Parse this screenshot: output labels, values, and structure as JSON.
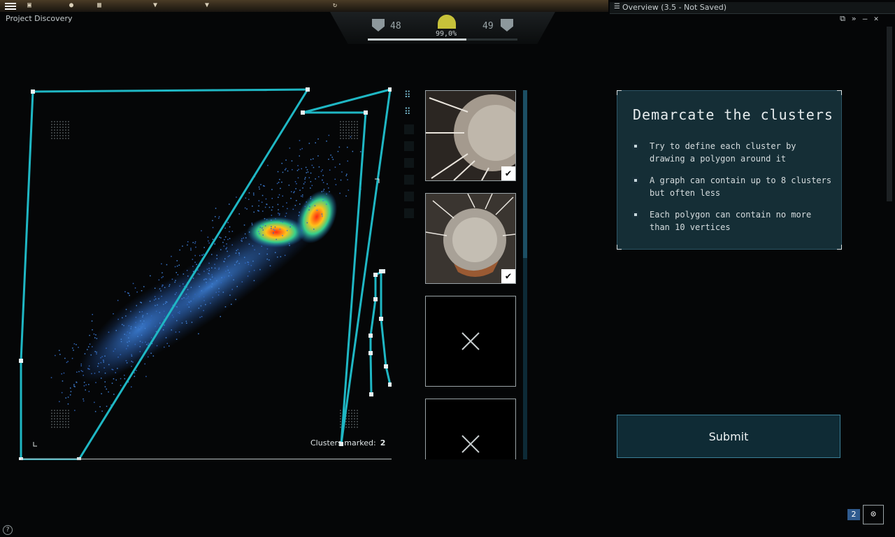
{
  "app": {
    "title": "Project Discovery"
  },
  "hud": {
    "left_count": "48",
    "right_count": "49",
    "accuracy": "99,0%",
    "progress": 0.66,
    "left_icon": "shield-rank-icon",
    "right_icon": "shield-rank-icon",
    "gauge_color": "#c7c23a"
  },
  "overview": {
    "title": "Overview (3.5 - Not Saved)",
    "controls": [
      "⧉",
      "»",
      "–",
      "✕"
    ]
  },
  "instructions": {
    "heading": "Demarcate the clusters",
    "items": [
      "Try to define each cluster by drawing a polygon around it",
      "A graph can contain up to 8 clusters but often less",
      "Each polygon can contain no more than 10 vertices"
    ]
  },
  "plot": {
    "clusters_label": "Clusters marked:",
    "clusters_count": "2",
    "polygon_color": "#1fb7c4"
  },
  "images": [
    {
      "state": "verified",
      "check": "✔"
    },
    {
      "state": "verified",
      "check": "✔"
    },
    {
      "state": "rejected"
    },
    {
      "state": "rejected"
    }
  ],
  "submit": {
    "label": "Submit"
  },
  "notifications": {
    "count": "2",
    "feed_icon": "rss-feed-icon"
  },
  "colors": {
    "accent": "#1fb7c4",
    "panel": "#18343e",
    "button_border": "#3b7f97"
  }
}
